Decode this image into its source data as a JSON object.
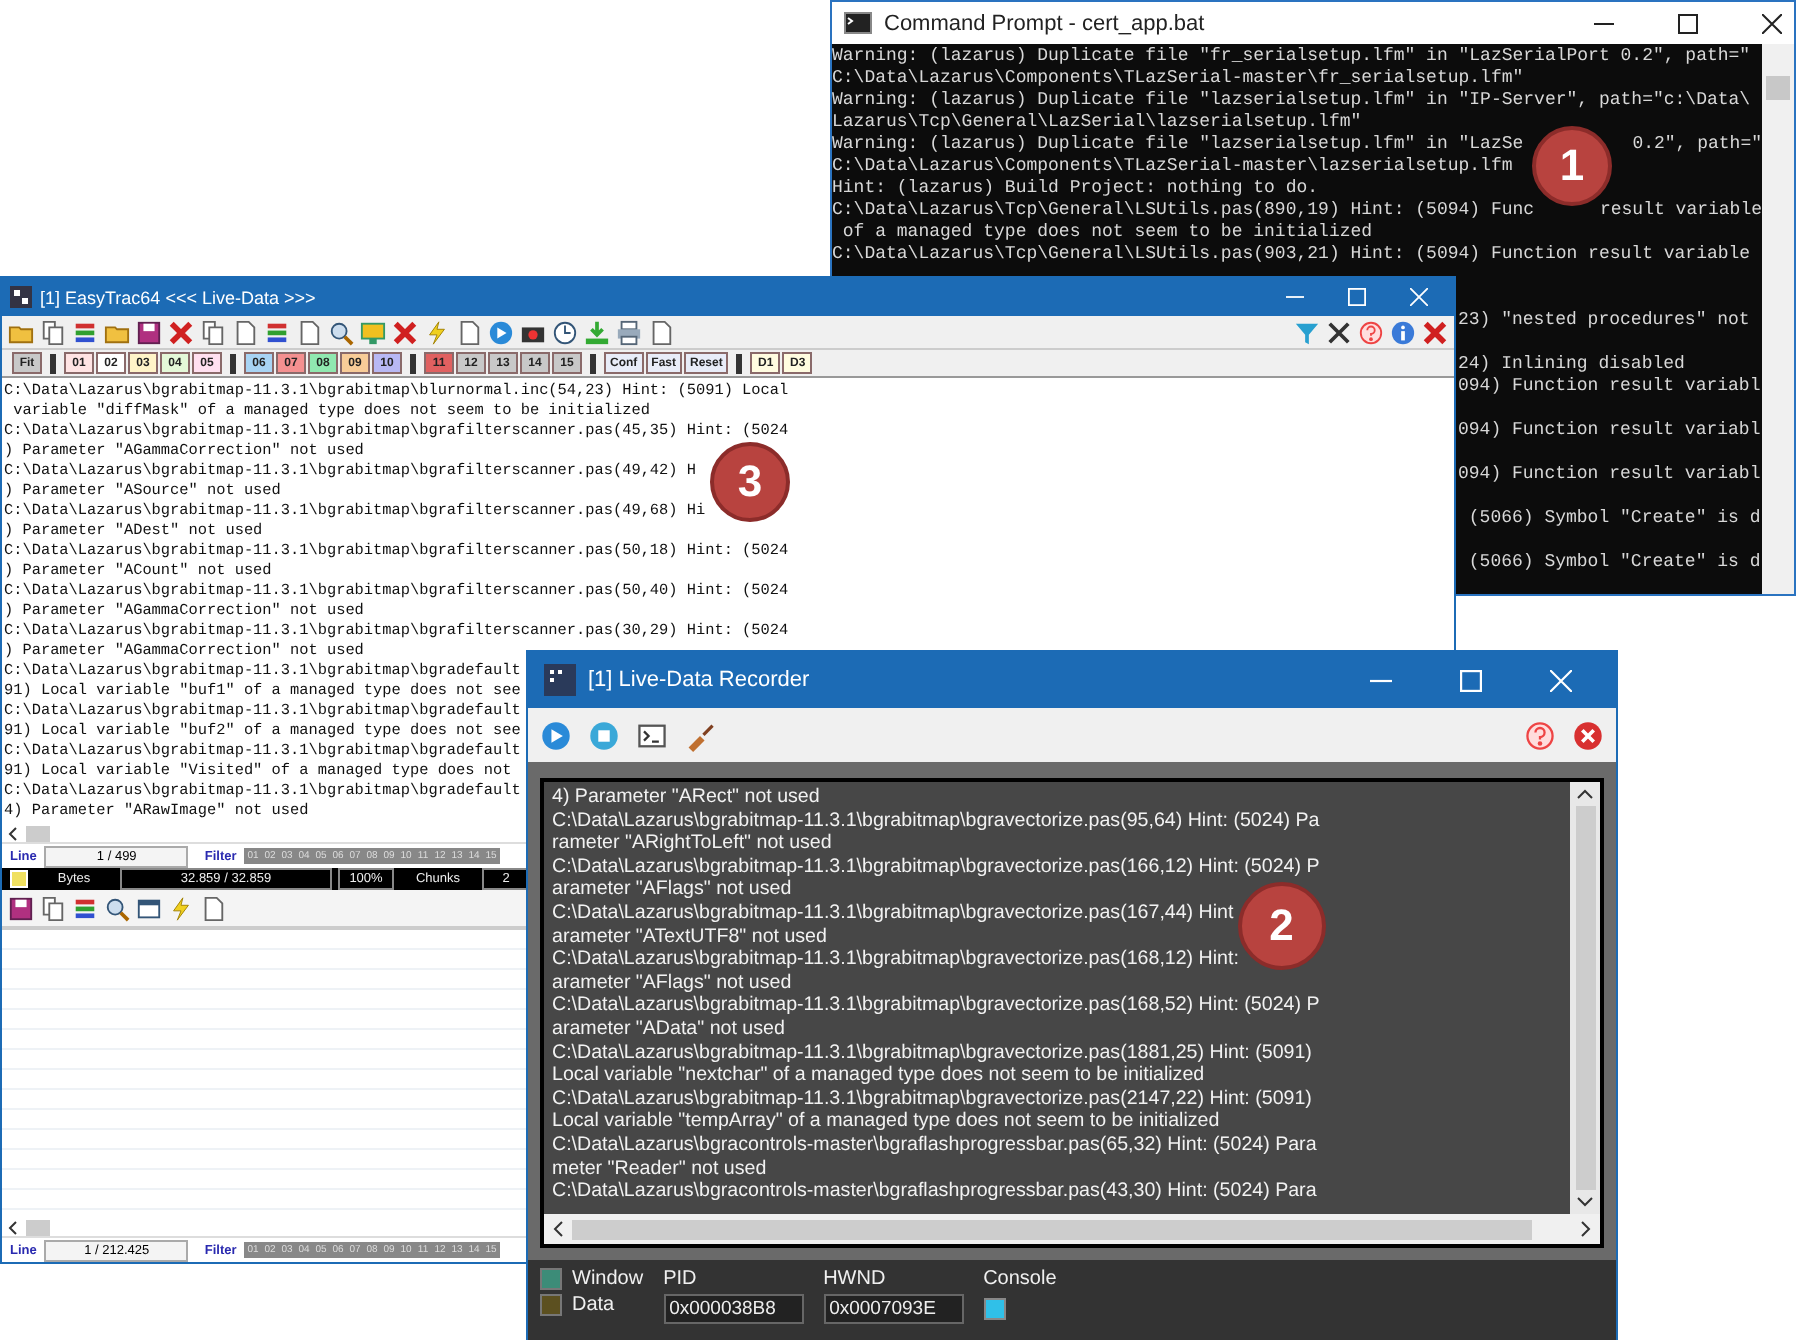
{
  "command_prompt": {
    "title": "Command Prompt - cert_app.bat",
    "lines": [
      [
        "Warning: (lazarus) Duplicate file \"fr_serialsetup.lfm\" in \"LazSerialPort 0.2\", path=\""
      ],
      [
        "C:\\Data\\Lazarus\\Components\\TLazSerial-master\\fr_serialsetup.lfm\""
      ],
      [
        "Warning: (lazarus) Duplicate file \"lazserialsetup.lfm\" in \"IP-Server\", path=\"c:\\Data\\"
      ],
      [
        "Lazarus\\Tcp\\General\\LazSerial\\lazserialsetup.lfm\""
      ],
      [
        "Warning: (lazarus) Duplicate file \"lazserialsetup.lfm\" in \"LazSe",
        "0.2\", path=\""
      ],
      [
        "C:\\Data\\Lazarus\\Components\\TLazSerial-master\\lazserialsetup.lfm"
      ],
      [
        "Hint: (lazarus) Build Project: nothing to do."
      ],
      [
        "C:\\Data\\Lazarus\\Tcp\\General\\LSUtils.pas(890,19) Hint: (5094) Func",
        "result variable"
      ],
      [
        " of a managed type does not seem to be initialized"
      ],
      [
        "C:\\Data\\Lazarus\\Tcp\\General\\LSUtils.pas(903,21) Hint: (5094) Function result variable"
      ]
    ],
    "fragments": [
      "23) \"nested procedures\" not",
      "24) Inlining disabled",
      "094) Function result variabl",
      "094) Function result variabl",
      "094) Function result variabl",
      " (5066) Symbol \"Create\" is d",
      " (5066) Symbol \"Create\" is d"
    ]
  },
  "easytrac": {
    "title": "[1] EasyTrac64 <<< Live-Data >>>",
    "button_groups": [
      [
        {
          "label": "Fit",
          "color": "#c8c8c8"
        }
      ],
      [
        {
          "label": "01",
          "color": "#ffe4e4"
        },
        {
          "label": "02",
          "color": "#ffffff"
        },
        {
          "label": "03",
          "color": "#fff4c8"
        },
        {
          "label": "04",
          "color": "#e4f8d8"
        },
        {
          "label": "05",
          "color": "#ffe0f0"
        }
      ],
      [
        {
          "label": "06",
          "color": "#a8d4f4"
        },
        {
          "label": "07",
          "color": "#f49090"
        },
        {
          "label": "08",
          "color": "#90e8b0"
        },
        {
          "label": "09",
          "color": "#f8cc98"
        },
        {
          "label": "10",
          "color": "#b8b8f4"
        }
      ],
      [
        {
          "label": "11",
          "color": "#e06060"
        },
        {
          "label": "12",
          "color": "#c8c8c8"
        },
        {
          "label": "13",
          "color": "#c8c8c8"
        },
        {
          "label": "14",
          "color": "#c8c8c8"
        },
        {
          "label": "15",
          "color": "#c8c8c8"
        }
      ],
      [
        {
          "label": "Conf",
          "color": "#e8ecf8"
        },
        {
          "label": "Fast",
          "color": "#e8ecf8"
        },
        {
          "label": "Reset",
          "color": "#e8ecf8"
        }
      ],
      [
        {
          "label": "D1",
          "color": "#fffce0"
        },
        {
          "label": "D3",
          "color": "#fffce0"
        }
      ]
    ],
    "log": [
      "C:\\Data\\Lazarus\\bgrabitmap-11.3.1\\bgrabitmap\\blurnormal.inc(54,23) Hint: (5091) Local",
      " variable \"diffMask\" of a managed type does not seem to be initialized",
      "C:\\Data\\Lazarus\\bgrabitmap-11.3.1\\bgrabitmap\\bgrafilterscanner.pas(45,35) Hint: (5024",
      ") Parameter \"AGammaCorrection\" not used",
      "C:\\Data\\Lazarus\\bgrabitmap-11.3.1\\bgrabitmap\\bgrafilterscanner.pas(49,42) H",
      ") Parameter \"ASource\" not used",
      "C:\\Data\\Lazarus\\bgrabitmap-11.3.1\\bgrabitmap\\bgrafilterscanner.pas(49,68) Hi",
      ") Parameter \"ADest\" not used",
      "C:\\Data\\Lazarus\\bgrabitmap-11.3.1\\bgrabitmap\\bgrafilterscanner.pas(50,18) Hint: (5024",
      ") Parameter \"ACount\" not used",
      "C:\\Data\\Lazarus\\bgrabitmap-11.3.1\\bgrabitmap\\bgrafilterscanner.pas(50,40) Hint: (5024",
      ") Parameter \"AGammaCorrection\" not used",
      "C:\\Data\\Lazarus\\bgrabitmap-11.3.1\\bgrabitmap\\bgrafilterscanner.pas(30,29) Hint: (5024",
      ") Parameter \"AGammaCorrection\" not used",
      "C:\\Data\\Lazarus\\bgrabitmap-11.3.1\\bgrabitmap\\bgradefault",
      "91) Local variable \"buf1\" of a managed type does not see",
      "C:\\Data\\Lazarus\\bgrabitmap-11.3.1\\bgrabitmap\\bgradefault",
      "91) Local variable \"buf2\" of a managed type does not see",
      "C:\\Data\\Lazarus\\bgrabitmap-11.3.1\\bgrabitmap\\bgradefault",
      "91) Local variable \"Visited\" of a managed type does not",
      "C:\\Data\\Lazarus\\bgrabitmap-11.3.1\\bgrabitmap\\bgradefault",
      "4) Parameter \"ARawImage\" not used"
    ],
    "line_status": {
      "label": "Line",
      "value": "1 / 499",
      "filter_label": "Filter",
      "chips": [
        "01",
        "02",
        "03",
        "04",
        "05",
        "06",
        "07",
        "08",
        "09",
        "10",
        "11",
        "12",
        "13",
        "14",
        "15"
      ]
    },
    "bytes_bar": {
      "label": "Bytes",
      "value": "32.859 / 32.859",
      "percent": "100%",
      "chunks_label": "Chunks",
      "chunks": "2"
    },
    "lower_status": {
      "label": "Line",
      "value": "1 / 212.425",
      "filter_label": "Filter",
      "chips": [
        "01",
        "02",
        "03",
        "04",
        "05",
        "06",
        "07",
        "08",
        "09",
        "10",
        "11",
        "12",
        "13",
        "14",
        "15"
      ]
    }
  },
  "recorder": {
    "title": "[1] Live-Data Recorder",
    "log": [
      "4) Parameter \"ARect\" not used",
      "C:\\Data\\Lazarus\\bgrabitmap-11.3.1\\bgrabitmap\\bgravectorize.pas(95,64) Hint: (5024) Pa",
      "rameter \"ARightToLeft\" not used",
      "C:\\Data\\Lazarus\\bgrabitmap-11.3.1\\bgrabitmap\\bgravectorize.pas(166,12) Hint: (5024) P",
      "arameter \"AFlags\" not used",
      "C:\\Data\\Lazarus\\bgrabitmap-11.3.1\\bgrabitmap\\bgravectorize.pas(167,44) Hint",
      "arameter \"ATextUTF8\" not used",
      "C:\\Data\\Lazarus\\bgrabitmap-11.3.1\\bgrabitmap\\bgravectorize.pas(168,12) Hint:",
      "arameter \"AFlags\" not used",
      "C:\\Data\\Lazarus\\bgrabitmap-11.3.1\\bgrabitmap\\bgravectorize.pas(168,52) Hint: (5024) P",
      "arameter \"AData\" not used",
      "C:\\Data\\Lazarus\\bgrabitmap-11.3.1\\bgrabitmap\\bgravectorize.pas(1881,25) Hint: (5091)",
      "Local variable \"nextchar\" of a managed type does not seem to be initialized",
      "C:\\Data\\Lazarus\\bgrabitmap-11.3.1\\bgrabitmap\\bgravectorize.pas(2147,22) Hint: (5091)",
      "Local variable \"tempArray\" of a managed type does not seem to be initialized",
      "C:\\Data\\Lazarus\\bgracontrols-master\\bgraflashprogressbar.pas(65,32) Hint: (5024) Para",
      "meter \"Reader\" not used",
      "C:\\Data\\Lazarus\\bgracontrols-master\\bgraflashprogressbar.pas(43,30) Hint: (5024) Para"
    ],
    "indicators": [
      {
        "label": "Window",
        "color": "#3c8c78"
      },
      {
        "label": "Data",
        "color": "#5c5020"
      }
    ],
    "fields": [
      {
        "label": "PID",
        "value": "0x000038B8"
      },
      {
        "label": "HWND",
        "value": "0x0007093E"
      }
    ],
    "console": {
      "label": "Console",
      "color": "#30c0e8"
    }
  },
  "badges": [
    {
      "label": "1"
    },
    {
      "label": "2"
    },
    {
      "label": "3"
    }
  ]
}
